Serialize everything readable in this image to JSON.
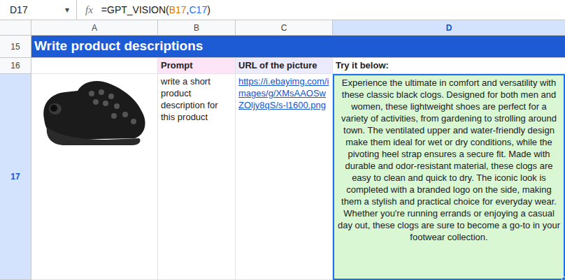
{
  "formula_bar": {
    "cell_ref": "D17",
    "dropdown": "▾",
    "fx": "fx",
    "formula_parts": [
      {
        "text": "=GPT_VISION(",
        "color": "#202124"
      },
      {
        "text": "B17",
        "color": "#e37400"
      },
      {
        "text": ",",
        "color": "#202124"
      },
      {
        "text": "C17",
        "color": "#1a73e8"
      },
      {
        "text": ")",
        "color": "#202124"
      }
    ]
  },
  "columns": [
    {
      "label": "A",
      "selected": false
    },
    {
      "label": "B",
      "selected": false
    },
    {
      "label": "C",
      "selected": false
    },
    {
      "label": "D",
      "selected": true
    }
  ],
  "rows": [
    {
      "label": "15",
      "selected": false
    },
    {
      "label": "16",
      "selected": false
    },
    {
      "label": "17",
      "selected": true
    }
  ],
  "title": "Write product descriptions",
  "headers": {
    "prompt": "Prompt",
    "url": "URL of the picture",
    "output": "Try it below:"
  },
  "entry": {
    "prompt": "write a short product description for this product",
    "url": "https://i.ebayimg.com/images/g/XMsAAOSwZOljy8qS/s-l1600.png",
    "output": "Experience the ultimate in comfort and versatility with these classic black clogs. Designed for both men and women, these lightweight shoes are perfect for a variety of activities, from gardening to strolling around town. The ventilated upper and water-friendly design make them ideal for wet or dry conditions, while the pivoting heel strap ensures a secure fit. Made with durable and odor-resistant material, these clogs are easy to clean and quick to dry. The iconic look is completed with a branded logo on the side, making them a stylish and practical choice for everyday wear. Whether you're running errands or enjoying a casual day out, these clogs are sure to become a go-to in your footwear collection.",
    "selected": true
  }
}
